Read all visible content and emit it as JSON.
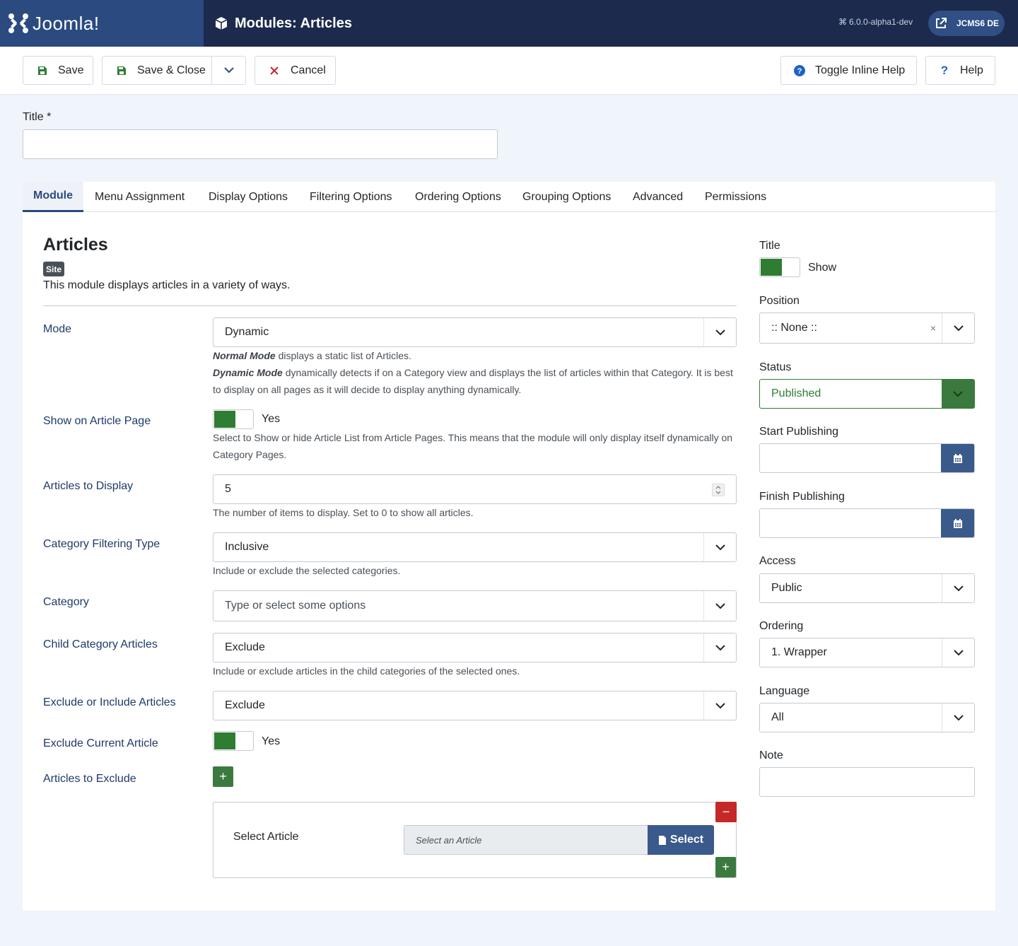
{
  "header": {
    "logo_text": "Joomla!",
    "page_title": "Modules: Articles",
    "version": "6.0.0-alpha1-dev",
    "site_name": "JCMS6 DE"
  },
  "toolbar": {
    "save": "Save",
    "save_close": "Save & Close",
    "cancel": "Cancel",
    "toggle_help": "Toggle Inline Help",
    "help": "Help"
  },
  "title_field": {
    "label": "Title *",
    "value": ""
  },
  "tabs": [
    "Module",
    "Menu Assignment",
    "Display Options",
    "Filtering Options",
    "Ordering Options",
    "Grouping Options",
    "Advanced",
    "Permissions"
  ],
  "module": {
    "heading": "Articles",
    "badge": "Site",
    "description": "This module displays articles in a variety of ways."
  },
  "fields": {
    "mode": {
      "label": "Mode",
      "value": "Dynamic",
      "help_normal_term": "Normal Mode",
      "help_normal": " displays a static list of Articles.",
      "help_dynamic_term": "Dynamic Mode",
      "help_dynamic": " dynamically detects if on a Category view and displays the list of articles within that Category. It is best to display on all pages as it will decide to display anything dynamically."
    },
    "show_on_article": {
      "label": "Show on Article Page",
      "value": "Yes",
      "help": "Select to Show or hide Article List from Article Pages. This means that the module will only display itself dynamically on Category Pages."
    },
    "articles_to_display": {
      "label": "Articles to Display",
      "value": "5",
      "help": "The number of items to display. Set to 0 to show all articles."
    },
    "category_filtering": {
      "label": "Category Filtering Type",
      "value": "Inclusive",
      "help": "Include or exclude the selected categories."
    },
    "category": {
      "label": "Category",
      "placeholder": "Type or select some options"
    },
    "child_category": {
      "label": "Child Category Articles",
      "value": "Exclude",
      "help": "Include or exclude articles in the child categories of the selected ones."
    },
    "exclude_include": {
      "label": "Exclude or Include Articles",
      "value": "Exclude"
    },
    "exclude_current": {
      "label": "Exclude Current Article",
      "value": "Yes"
    },
    "articles_to_exclude": {
      "label": "Articles to Exclude",
      "row_label": "Select Article",
      "placeholder": "Select an Article",
      "select_button": "Select"
    }
  },
  "sidebar": {
    "title": {
      "label": "Title",
      "value": "Show"
    },
    "position": {
      "label": "Position",
      "value": ":: None ::"
    },
    "status": {
      "label": "Status",
      "value": "Published"
    },
    "start_publishing": {
      "label": "Start Publishing",
      "value": ""
    },
    "finish_publishing": {
      "label": "Finish Publishing",
      "value": ""
    },
    "access": {
      "label": "Access",
      "value": "Public"
    },
    "ordering": {
      "label": "Ordering",
      "value": "1. Wrapper"
    },
    "language": {
      "label": "Language",
      "value": "All"
    },
    "note": {
      "label": "Note",
      "value": ""
    }
  },
  "colors": {
    "header_bg": "#1c2a4d",
    "brand_bg": "#2a4a80",
    "toggle_on": "#2e7d32",
    "danger": "#c52827",
    "primary_btn": "#3a5a8c"
  }
}
